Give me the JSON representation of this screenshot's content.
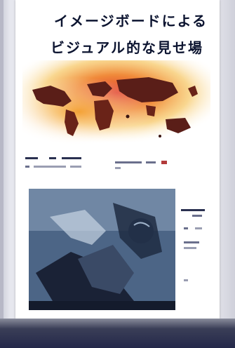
{
  "headline": {
    "line1": "イメージボードによる",
    "line2": "ビジュアル的な見せ場"
  },
  "colors": {
    "page_background": "#ffffff",
    "headline_text": "#0c1430",
    "map_heat_red": "#e0402e",
    "map_heat_orange": "#f4a030",
    "photo_blue": "#425a7a"
  },
  "figures": {
    "map_image": "heat-map-world-image",
    "photo_image": "character-sketch-photo"
  }
}
